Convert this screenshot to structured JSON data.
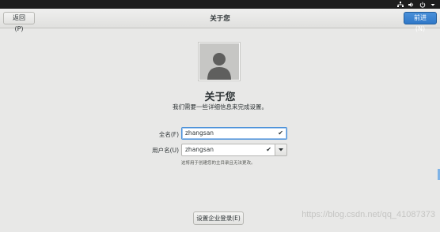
{
  "header": {
    "prev_label": "返回(P)",
    "title": "关于您",
    "next_label": "前进(N)"
  },
  "system_tray": {
    "icons": [
      "network-icon",
      "volume-icon",
      "power-icon",
      "caret-down-icon"
    ]
  },
  "main": {
    "title": "关于您",
    "subtitle": "我们需要一些详细信息来完成设置。",
    "fullname": {
      "label": "全名(F)",
      "value": "zhangsan"
    },
    "username": {
      "label": "用户名(U)",
      "value": "zhangsan",
      "hint": "这将用于创建您的主目录且无法更改。"
    },
    "enterprise_login_label": "设置企业登录(E)"
  },
  "watermark": "https://blog.csdn.net/qq_41087373",
  "colors": {
    "accent": "#4a90d9",
    "topbar": "#1d1d1d",
    "background": "#e8e8e7"
  }
}
